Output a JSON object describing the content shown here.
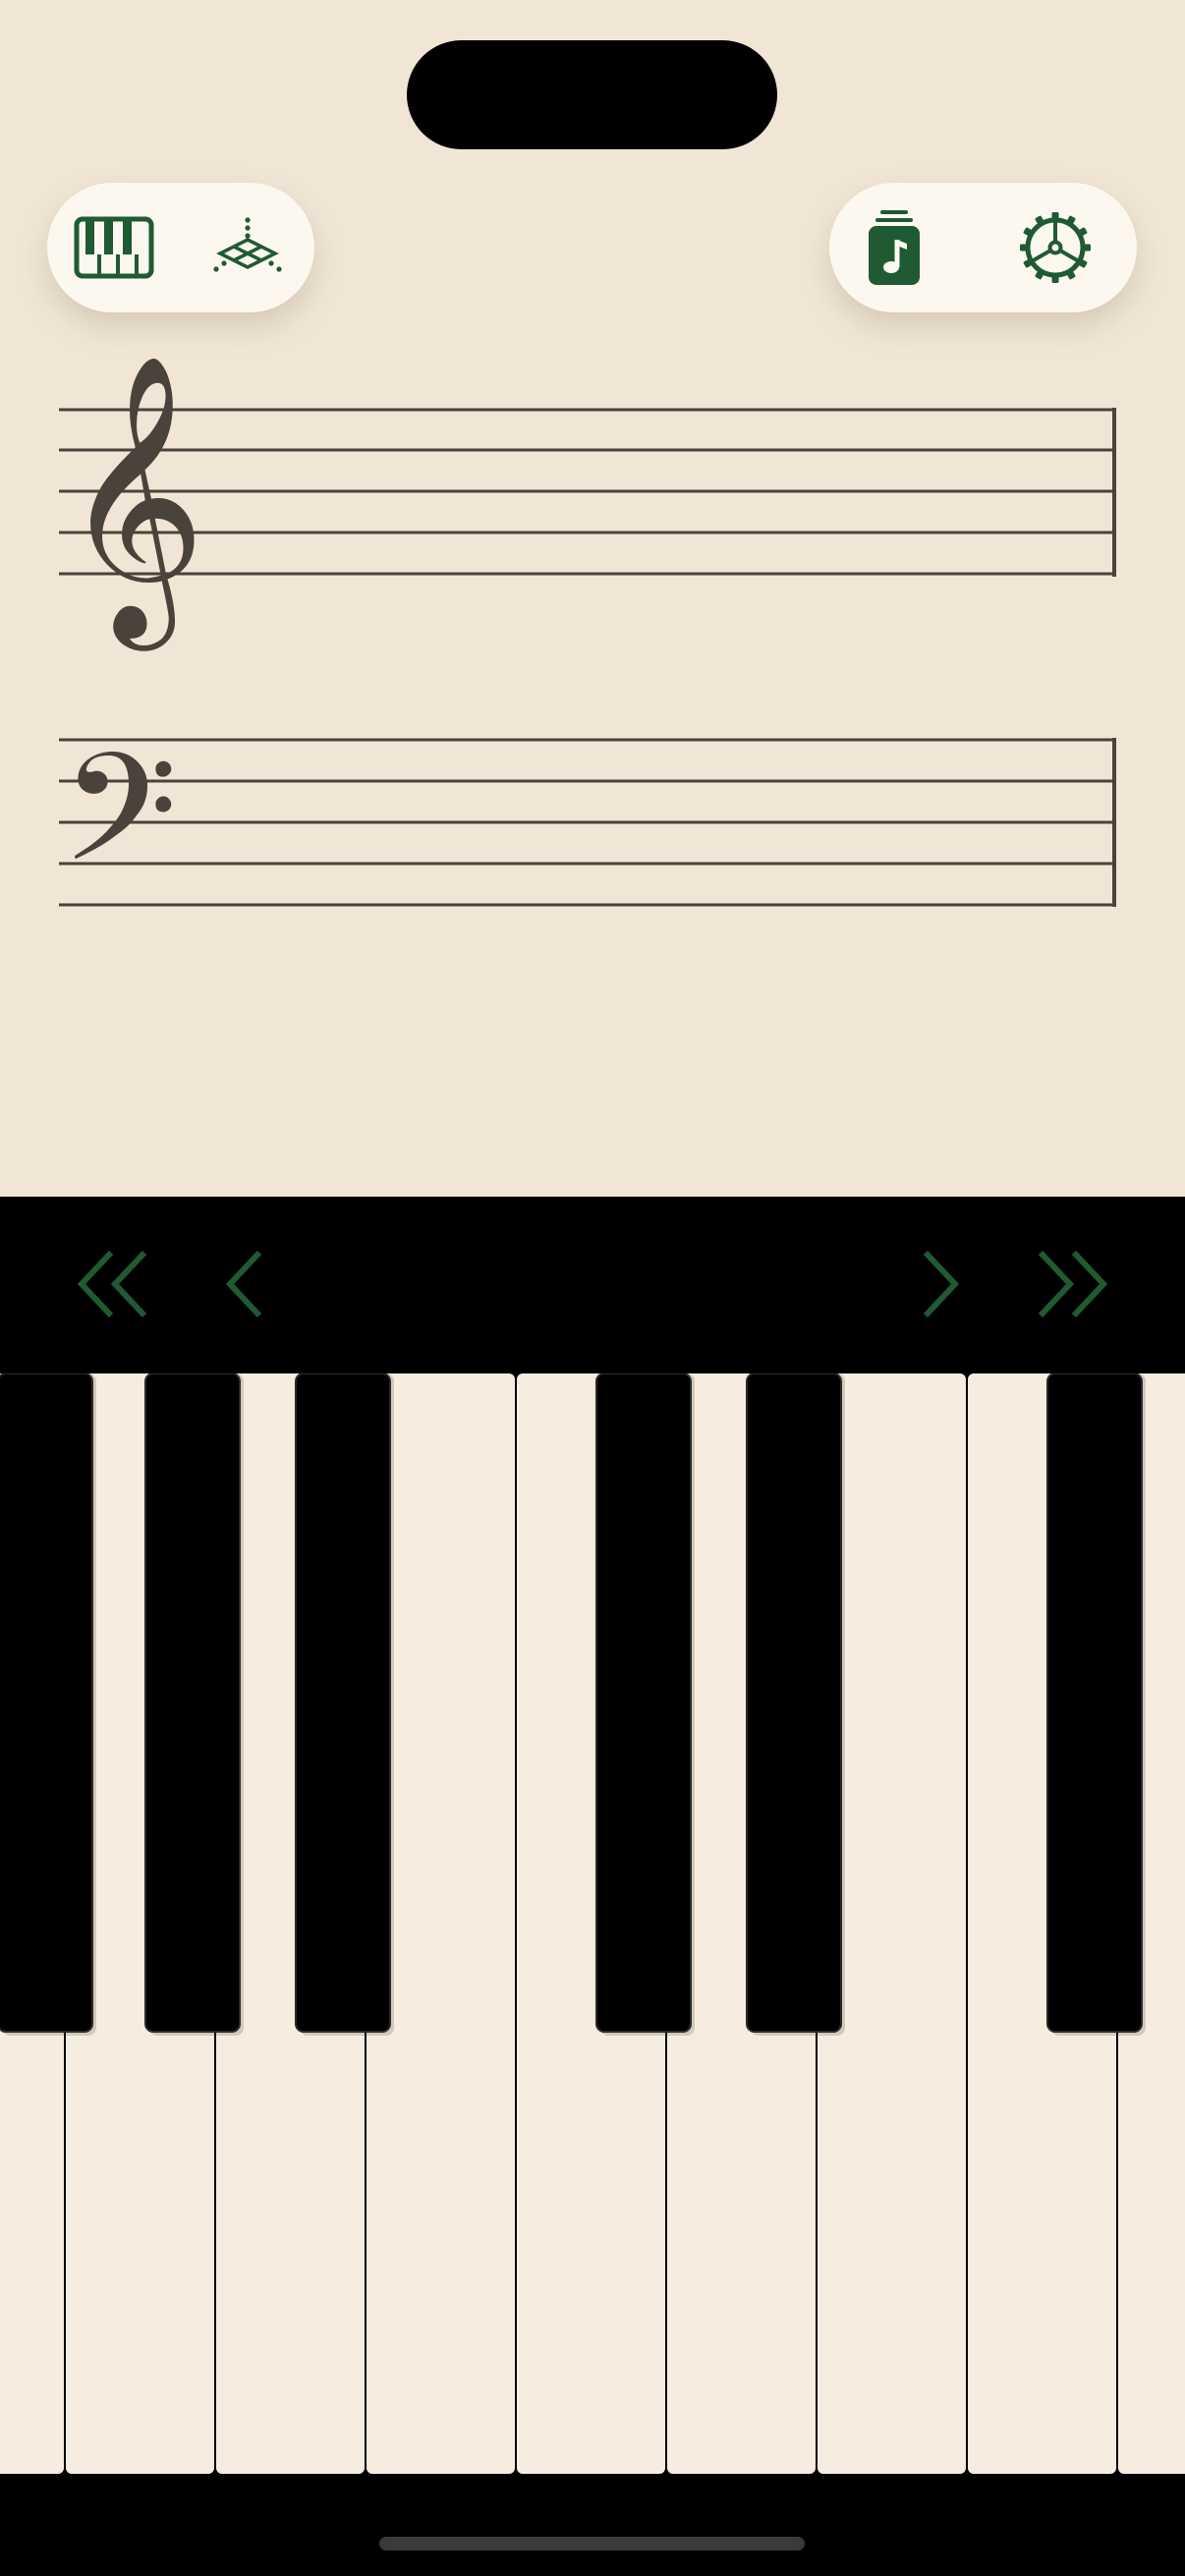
{
  "colors": {
    "paper": "#f1e6d6",
    "accent_green": "#1f5a32",
    "staff_ink": "#4a433b",
    "white_key": "#f6ece0",
    "black_key": "#000000"
  },
  "toolbar_left": {
    "items": [
      {
        "icon": "piano-keyboard-icon"
      },
      {
        "icon": "pattern-grid-icon"
      }
    ]
  },
  "toolbar_right": {
    "items": [
      {
        "icon": "music-library-icon"
      },
      {
        "icon": "gear-icon"
      }
    ]
  },
  "staff": {
    "treble_clef": "𝄞",
    "bass_clef": "𝄢"
  },
  "navigation": {
    "items": [
      {
        "icon": "double-chevron-left-icon"
      },
      {
        "icon": "chevron-left-icon"
      },
      {
        "icon": "chevron-right-icon"
      },
      {
        "icon": "double-chevron-right-icon"
      }
    ]
  },
  "keyboard": {
    "white_key_count": 9,
    "black_key_count": 6
  }
}
